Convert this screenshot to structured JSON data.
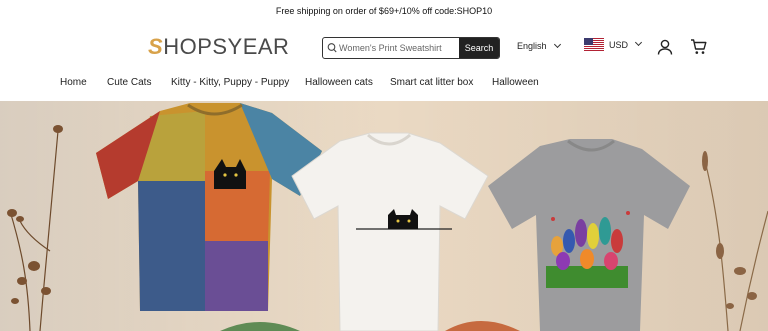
{
  "announcement": "Free shipping on order of $69+/10% off code:SHOP10",
  "logo": {
    "mark": "S",
    "text": "HOPSYEAR"
  },
  "search": {
    "placeholder": "Women's Print Sweatshirt",
    "button_label": "Search"
  },
  "language": "English",
  "currency": "USD",
  "icons": {
    "user": "user-icon",
    "cart": "cart-icon",
    "search": "search-icon"
  },
  "nav": {
    "items": [
      {
        "label": "Home"
      },
      {
        "label": "Cute Cats"
      },
      {
        "label": "Kitty - Kitty, Puppy - Puppy"
      },
      {
        "label": "Halloween cats"
      },
      {
        "label": "Smart cat litter box"
      },
      {
        "label": "Halloween"
      }
    ]
  },
  "colors": {
    "accent": "#d8a24a",
    "button": "#222222",
    "hero_bg": "#ead9c3"
  }
}
